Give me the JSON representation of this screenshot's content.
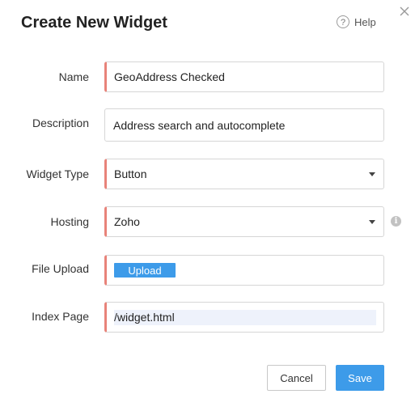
{
  "dialog": {
    "title": "Create New Widget",
    "help_label": "Help",
    "help_icon_glyph": "?",
    "close_icon_glyph": "×"
  },
  "form": {
    "name": {
      "label": "Name",
      "value": "GeoAddress Checked"
    },
    "description": {
      "label": "Description",
      "value": "Address search and autocomplete"
    },
    "widget_type": {
      "label": "Widget Type",
      "value": "Button"
    },
    "hosting": {
      "label": "Hosting",
      "value": "Zoho",
      "info_icon_glyph": "i"
    },
    "file_upload": {
      "label": "File Upload",
      "button_label": "Upload"
    },
    "index_page": {
      "label": "Index Page",
      "value": "/widget.html"
    }
  },
  "footer": {
    "cancel_label": "Cancel",
    "save_label": "Save"
  },
  "colors": {
    "accent": "#3d9be9",
    "required_marker": "#e8837a",
    "border": "#d6d6d6"
  }
}
